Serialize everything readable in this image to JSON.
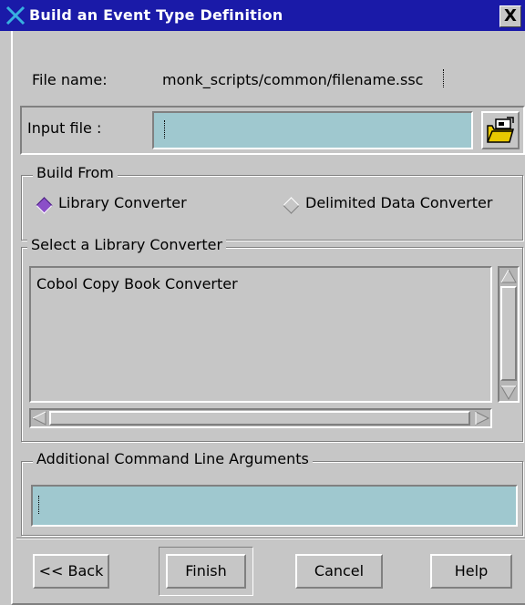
{
  "window": {
    "title": "Build an Event Type Definition",
    "close_label": "X"
  },
  "file_name": {
    "label": "File name:",
    "value": "monk_scripts/common/filename.ssc"
  },
  "input_file": {
    "label": "Input file :",
    "value": "",
    "browse_icon": "folder-browse-icon"
  },
  "build_from": {
    "label": "Build From",
    "options": [
      "Library Converter",
      "Delimited Data Converter"
    ],
    "selected": "Library Converter"
  },
  "library_converter": {
    "label": "Select a Library Converter",
    "items": [
      "Cobol Copy Book Converter"
    ]
  },
  "arguments": {
    "label": "Additional Command Line Arguments",
    "value": ""
  },
  "buttons": {
    "back": "<< Back",
    "finish": "Finish",
    "cancel": "Cancel",
    "help": "Help"
  },
  "colors": {
    "titlebar": "#1a1aa8",
    "field": "#9fc8cf",
    "selected_radio": "#8b4fc8",
    "window": "#c6c6c6"
  }
}
